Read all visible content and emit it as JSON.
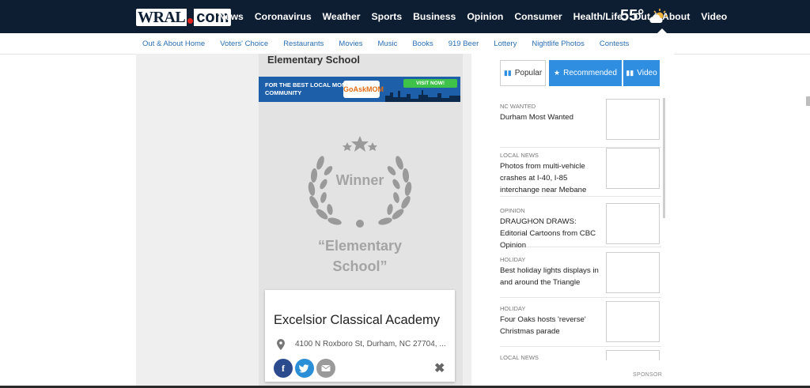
{
  "header": {
    "logo_text": "WRAL",
    "logo_suffix": "com",
    "nav": [
      "News",
      "Coronavirus",
      "Weather",
      "Sports",
      "Business",
      "Opinion",
      "Consumer",
      "Health/Life",
      "Out & About",
      "Video"
    ],
    "active_nav": "Out & About",
    "temperature": "55°",
    "weather_icon": "partly-cloudy-icon"
  },
  "subnav": [
    "Out & About Home",
    "Voters' Choice",
    "Restaurants",
    "Movies",
    "Music",
    "Books",
    "919 Beer",
    "Lottery",
    "Nightlife Photos",
    "Contests"
  ],
  "main": {
    "section_title": "Elementary School",
    "ad": {
      "tagline": "FOR THE BEST LOCAL MOM COMMUNITY",
      "brand": "GoAskMOM",
      "button": "VISIT NOW!"
    },
    "badge_label": "Winner",
    "category": "“Elementary School”",
    "card": {
      "name": "Excelsior Classical Academy",
      "address": "4100 N Roxboro St, Durham, NC 27704, ...",
      "share_facebook": "f",
      "close": "✖"
    }
  },
  "sidebar": {
    "tabs": [
      "Popular",
      "Recommended",
      "Video"
    ],
    "active_tab": "Popular",
    "stories": [
      {
        "category": "NC WANTED",
        "title": "Durham Most Wanted"
      },
      {
        "category": "LOCAL NEWS",
        "title": "Photos from multi-vehicle crashes at I-40, I-85 interchange near Mebane"
      },
      {
        "category": "OPINION",
        "title": "DRAUGHON DRAWS: Editorial Cartoons from CBC Opinion"
      },
      {
        "category": "HOLIDAY",
        "title": "Best holiday lights displays in and around the Triangle"
      },
      {
        "category": "HOLIDAY",
        "title": "Four Oaks hosts 'reverse' Christmas parade"
      },
      {
        "category": "LOCAL NEWS",
        "title": ""
      }
    ],
    "sponsor_label": "SPONSOR"
  },
  "colors": {
    "nav_bg": "#0d1e33",
    "link_blue": "#2a6fb5",
    "tab_blue": "#2f8ee0",
    "facebook": "#2b4b8e",
    "twitter": "#2b8fd8"
  }
}
